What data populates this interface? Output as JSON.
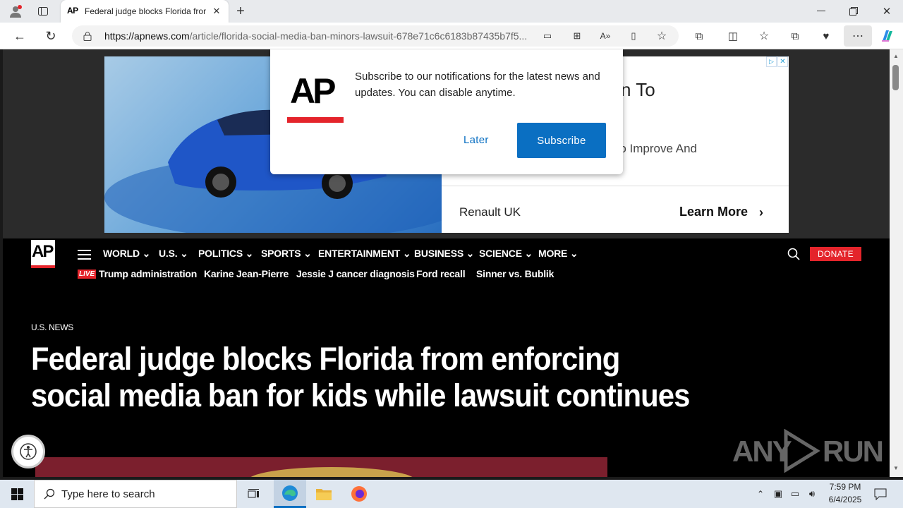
{
  "browser": {
    "tab_title": "Federal judge blocks Florida from",
    "tab_favicon": "AP",
    "url_main": "https://apnews.com",
    "url_rest": "/article/florida-social-media-ban-minors-lawsuit-678e71c6c6183b87435b7f5...",
    "new_tab": "+"
  },
  "ad": {
    "advertiser": "Renault UK",
    "cta": "Learn More",
    "headline_partial": "n To",
    "sub_partial": "e To Improve And"
  },
  "popup": {
    "logo": "AP",
    "message": "Subscribe to our notifications for the latest news and updates. You can disable anytime.",
    "later": "Later",
    "subscribe": "Subscribe"
  },
  "nav": {
    "logo": "AP",
    "items": [
      "WORLD",
      "U.S.",
      "POLITICS",
      "SPORTS",
      "ENTERTAINMENT",
      "BUSINESS",
      "SCIENCE",
      "MORE"
    ],
    "donate": "DONATE",
    "live_badge": "LIVE",
    "trending": [
      "Trump administration",
      "Karine Jean-Pierre",
      "Jessie J cancer diagnosis",
      "Ford recall",
      "Sinner vs. Bublik"
    ]
  },
  "article": {
    "section": "U.S. NEWS",
    "headline_line1": "Federal judge blocks Florida from enforcing",
    "headline_line2": "social media ban for kids while lawsuit continues"
  },
  "watermark": {
    "left": "ANY",
    "right": "RUN"
  },
  "taskbar": {
    "search_placeholder": "Type here to search",
    "time": "7:59 PM",
    "date": "6/4/2025"
  },
  "colors": {
    "ap_red": "#e4242b",
    "subscribe_blue": "#0a6fc2",
    "donate_red": "#e4242b"
  }
}
